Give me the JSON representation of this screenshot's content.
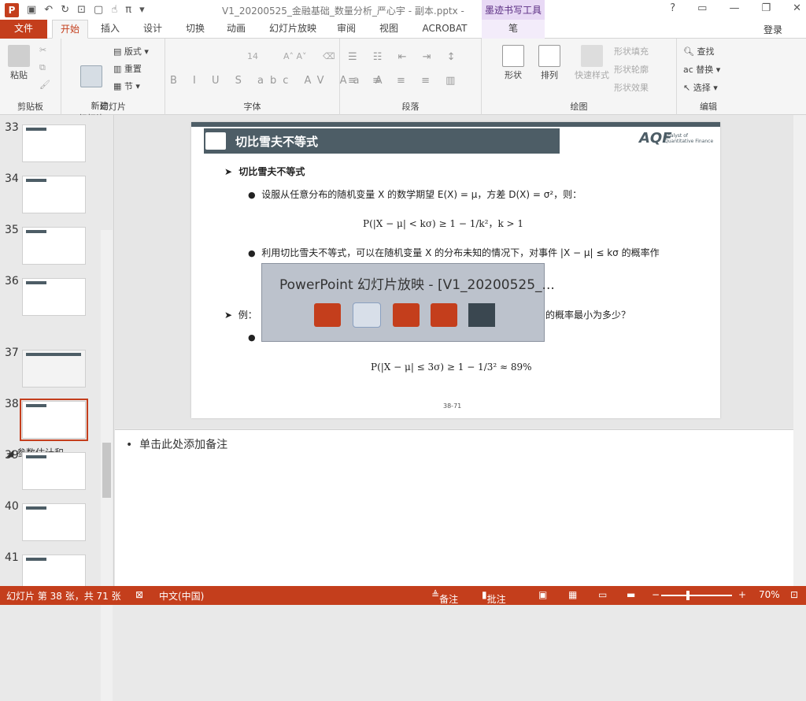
{
  "titlebar": {
    "app_logo": "P",
    "doc_title": "V1_20200525_金融基础_数量分析_严心宇 - 副本.pptx - ...",
    "tool_title": "墨迹书写工具"
  },
  "tabs": [
    "文件",
    "开始",
    "插入",
    "设计",
    "切换",
    "动画",
    "幻灯片放映",
    "审阅",
    "视图",
    "ACROBAT",
    "笔"
  ],
  "login": "登录",
  "ribbon": {
    "clipboard": {
      "paste": "粘贴",
      "label": "剪贴板"
    },
    "slides": {
      "new_slide": "新建\n幻灯片",
      "layout": "版式",
      "reset": "重置",
      "section": "节",
      "label": "幻灯片"
    },
    "font": {
      "size": "14",
      "label": "字体",
      "format_buttons": "B I U S abc AV Aa A"
    },
    "paragraph": {
      "label": "段落"
    },
    "drawing": {
      "shape": "形状",
      "arrange": "排列",
      "quick_style": "快速样式",
      "fill": "形状填充",
      "outline": "形状轮廓",
      "effect": "形状效果",
      "label": "绘图"
    },
    "editing": {
      "find": "查找",
      "replace": "替换",
      "select": "选择",
      "label": "编辑"
    }
  },
  "thumbs": [
    {
      "num": "33"
    },
    {
      "num": "34"
    },
    {
      "num": "35"
    },
    {
      "num": "36"
    },
    {
      "num": "37"
    },
    {
      "num": "38"
    },
    {
      "num": "39"
    },
    {
      "num": "40"
    },
    {
      "num": "41"
    }
  ],
  "section_label": "参数估计和...",
  "slide": {
    "title": "切比雪夫不等式",
    "logo_text": "AQF",
    "logo_sub": "Analyst of Quantitative Finance",
    "heading": "切比雪夫不等式",
    "bullet1": "设服从任意分布的随机变量 X 的数学期望 E(X) = μ，方差 D(X) = σ²，则：",
    "formula1": "P(|X − μ| < kσ) ≥ 1 − 1/k²，k > 1",
    "bullet2": "利用切比雪夫不等式，可以在随机变量 X 的分布未知的情况下，对事件 |X − μ| ≤ kσ 的概率作",
    "example_prefix": "例：",
    "example_suffix": "的概率最小为多少？",
    "formula2": "P(|X − μ| ≤ 3σ) ≥ 1 − 1/3² ≈ 89%",
    "page": "38-71"
  },
  "popup": {
    "title": "PowerPoint 幻灯片放映 - [V1_20200525_..."
  },
  "notes": {
    "placeholder": "单击此处添加备注"
  },
  "status": {
    "slide_info": "幻灯片 第 38 张，共 71 张",
    "language": "中文(中国)",
    "notes": "备注",
    "comments": "批注",
    "zoom": "70%"
  }
}
